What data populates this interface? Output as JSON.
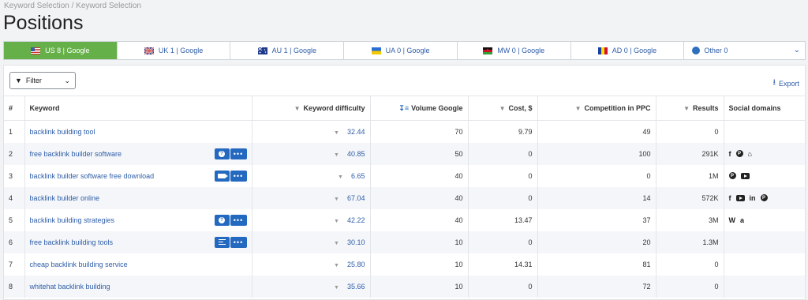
{
  "breadcrumb": "Keyword Selection / Keyword Selection",
  "title": "Positions",
  "tabs": [
    {
      "label": "US 8 | Google",
      "active": true
    },
    {
      "label": "UK 1 | Google",
      "active": false
    },
    {
      "label": "AU 1 | Google",
      "active": false
    },
    {
      "label": "UA 0 | Google",
      "active": false
    },
    {
      "label": "MW 0 | Google",
      "active": false
    },
    {
      "label": "AD 0 | Google",
      "active": false
    },
    {
      "label": "Other 0",
      "active": false
    }
  ],
  "toolbar": {
    "filter_label": "Filter",
    "export_label": "Export"
  },
  "columns": {
    "num": "#",
    "keyword": "Keyword",
    "kd": "Keyword difficulty",
    "volume": "Volume Google",
    "cost": "Cost, $",
    "competition": "Competition in PPC",
    "results": "Results",
    "social": "Social domains"
  },
  "rows": [
    {
      "num": "1",
      "keyword": "backlink building tool",
      "kd": "32.44",
      "volume": "70",
      "cost": "9.79",
      "competition": "49",
      "results": "0",
      "actions": [],
      "social": []
    },
    {
      "num": "2",
      "keyword": "free backlink builder software",
      "kd": "40.85",
      "volume": "50",
      "cost": "0",
      "competition": "100",
      "results": "291K",
      "actions": [
        "question-icon"
      ],
      "social": [
        "facebook-icon",
        "pinterest-icon",
        "shop-icon"
      ]
    },
    {
      "num": "3",
      "keyword": "backlink builder software free download",
      "kd": "6.65",
      "volume": "40",
      "cost": "0",
      "competition": "0",
      "results": "1M",
      "actions": [
        "video-icon"
      ],
      "social": [
        "pinterest-icon",
        "youtube-icon"
      ]
    },
    {
      "num": "4",
      "keyword": "backlink builder online",
      "kd": "67.04",
      "volume": "40",
      "cost": "0",
      "competition": "14",
      "results": "572K",
      "actions": [],
      "social": [
        "facebook-icon",
        "youtube-icon",
        "linkedin-icon",
        "pinterest-icon"
      ]
    },
    {
      "num": "5",
      "keyword": "backlink building strategies",
      "kd": "42.22",
      "volume": "40",
      "cost": "13.47",
      "competition": "37",
      "results": "3M",
      "actions": [
        "question-icon"
      ],
      "social": [
        "wikipedia-icon",
        "amazon-icon"
      ]
    },
    {
      "num": "6",
      "keyword": "free backlink building tools",
      "kd": "30.10",
      "volume": "10",
      "cost": "0",
      "competition": "20",
      "results": "1.3M",
      "actions": [
        "list-icon"
      ],
      "social": []
    },
    {
      "num": "7",
      "keyword": "cheap backlink building service",
      "kd": "25.80",
      "volume": "10",
      "cost": "14.31",
      "competition": "81",
      "results": "0",
      "actions": [],
      "social": []
    },
    {
      "num": "8",
      "keyword": "whitehat backlink building",
      "kd": "35.66",
      "volume": "10",
      "cost": "0",
      "competition": "72",
      "results": "0",
      "actions": [],
      "social": []
    }
  ],
  "colors": {
    "active_tab": "#65b049",
    "link": "#2f5ea8",
    "action_button": "#2469c0"
  }
}
